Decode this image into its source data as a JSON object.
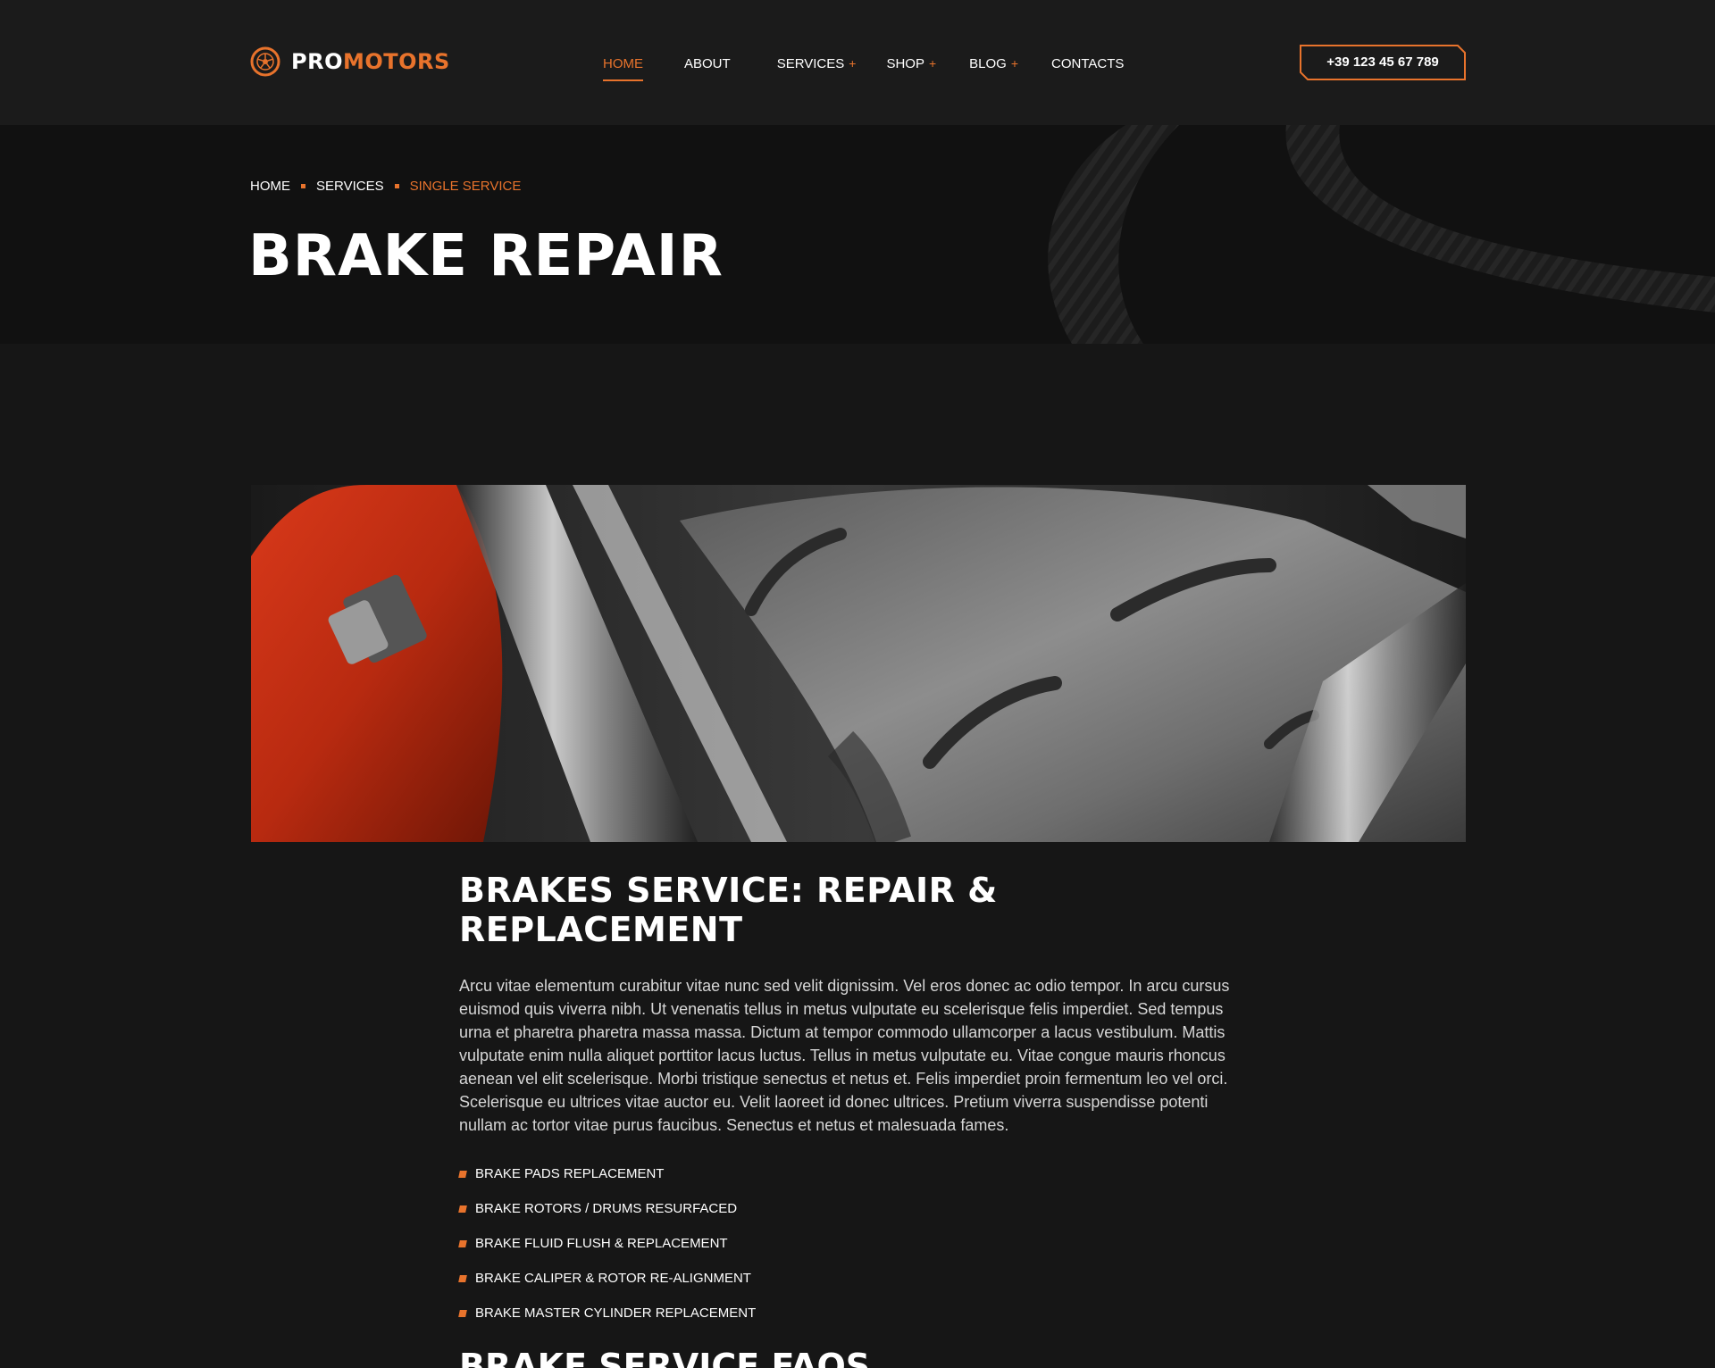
{
  "brand": {
    "name_part1": "PRO",
    "name_part2": "MOTORS",
    "accent_color": "#e8732c"
  },
  "nav": {
    "items": [
      {
        "label": "HOME",
        "has_submenu": false,
        "active": true
      },
      {
        "label": "ABOUT",
        "has_submenu": false,
        "active": false
      },
      {
        "label": "SERVICES",
        "has_submenu": true,
        "active": false
      },
      {
        "label": "SHOP",
        "has_submenu": true,
        "active": false
      },
      {
        "label": "BLOG",
        "has_submenu": true,
        "active": false
      },
      {
        "label": "CONTACTS",
        "has_submenu": false,
        "active": false
      }
    ],
    "submenu_marker": "+"
  },
  "header": {
    "phone": "+39 123 45 67 789"
  },
  "breadcrumb": {
    "items": [
      "HOME",
      "SERVICES",
      "SINGLE SERVICE"
    ]
  },
  "page": {
    "title": "BRAKE REPAIR"
  },
  "service": {
    "heading": "BRAKES SERVICE: REPAIR & REPLACEMENT",
    "description": "Arcu vitae elementum curabitur vitae nunc sed velit dignissim. Vel eros donec ac odio tempor. In arcu cursus euismod quis viverra nibh. Ut venenatis tellus in metus vulputate eu scelerisque felis imperdiet. Sed tempus urna et pharetra pharetra massa massa. Dictum at tempor commodo ullamcorper a lacus vestibulum. Mattis vulputate enim nulla aliquet porttitor lacus luctus. Tellus in metus vulputate eu. Vitae congue mauris rhoncus aenean vel elit scelerisque. Morbi tristique senectus et netus et. Felis imperdiet proin fermentum leo vel orci. Scelerisque eu ultrices vitae auctor eu. Velit laoreet id donec ultrices. Pretium viverra suspendisse potenti nullam ac tortor vitae purus faucibus. Senectus et netus et malesuada fames.",
    "features": [
      "BRAKE PADS REPLACEMENT",
      "BRAKE ROTORS / DRUMS RESURFACED",
      "BRAKE FLUID FLUSH & REPLACEMENT",
      "BRAKE CALIPER & ROTOR RE-ALIGNMENT",
      "BRAKE MASTER CYLINDER REPLACEMENT"
    ]
  },
  "faq": {
    "heading": "BRAKE SERVICE FAQS"
  },
  "icons": {
    "logo": "wheel-logo-icon",
    "bullet": "square-bullet-icon"
  }
}
